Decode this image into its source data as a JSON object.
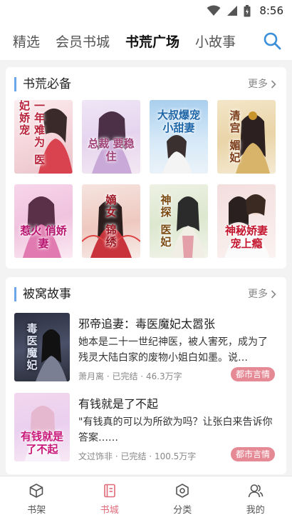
{
  "status_bar": {
    "time": "8:56",
    "icons": [
      "wifi-icon",
      "signal-icon",
      "battery-icon"
    ]
  },
  "top_tabs": [
    {
      "label": "精选",
      "active": false
    },
    {
      "label": "会员书城",
      "active": false
    },
    {
      "label": "书荒广场",
      "active": true
    },
    {
      "label": "小故事",
      "active": false
    }
  ],
  "section1": {
    "title": "书荒必备",
    "more": "更多",
    "covers": [
      {
        "text": "一年难为 医妃娇宠",
        "palette": "pink-white"
      },
      {
        "text": "总裁 要稳住",
        "palette": "lavender"
      },
      {
        "text": "大叔爆宠 小甜妻",
        "palette": "sky"
      },
      {
        "text": "清宫 媚妃",
        "palette": "gold"
      },
      {
        "text": "惹火 俏娇妻",
        "palette": "magenta"
      },
      {
        "text": "嫡女 锦绣",
        "palette": "red"
      },
      {
        "text": "神探 医妃",
        "palette": "green"
      },
      {
        "text": "神秘娇妻 宠上瘾",
        "palette": "rose"
      }
    ]
  },
  "section2": {
    "title": "被窝故事",
    "more": "更多",
    "books": [
      {
        "title": "邪帝追妻：毒医魔妃太嚣张",
        "description": "她本是二十一世纪神医，被人害死，成为了残灵大陆白家的废物小姐白如墨。说…",
        "author": "萧月离",
        "status": "已完结",
        "words": "46.3万字",
        "tag": "都市言情",
        "cover_text": "毒医魔妃"
      },
      {
        "title": "有钱就是了不起",
        "description": "\"有钱真的可以为所欲为吗？让张白来告诉你答案……",
        "author": "文过饰非",
        "status": "已完结",
        "words": "100.5万字",
        "tag": "都市言情",
        "cover_text": "有钱就是了不起"
      }
    ]
  },
  "bottom_nav": [
    {
      "label": "书架",
      "icon": "cube-icon",
      "active": false
    },
    {
      "label": "书城",
      "icon": "book-icon",
      "active": true
    },
    {
      "label": "分类",
      "icon": "hexagon-icon",
      "active": false
    },
    {
      "label": "我的",
      "icon": "user-icon",
      "active": false
    }
  ],
  "colors": {
    "accent": "#e06a7a",
    "title_bar": "#6aa6e8",
    "tag": "#e58a95"
  }
}
